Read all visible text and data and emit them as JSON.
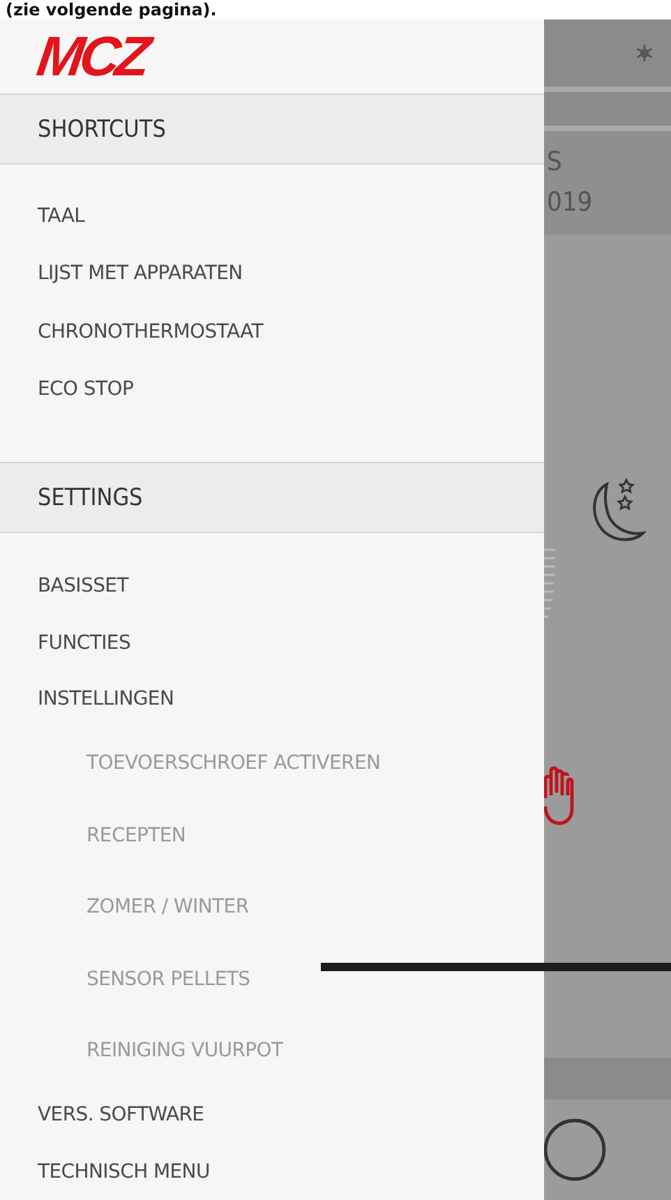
{
  "caption": "(zie volgende pagina).",
  "drawer": {
    "logo": "MCZ",
    "sections": [
      {
        "title": "SHORTCUTS",
        "items": [
          {
            "label": "TAAL"
          },
          {
            "label": "LIJST MET APPARATEN"
          },
          {
            "label": "CHRONOTHERMOSTAAT"
          },
          {
            "label": "ECO STOP"
          }
        ]
      },
      {
        "title": "SETTINGS",
        "items": [
          {
            "label": "BASISSET"
          },
          {
            "label": "FUNCTIES"
          },
          {
            "label": "INSTELLINGEN",
            "children": [
              {
                "label": "TOEVOERSCHROEF ACTIVEREN"
              },
              {
                "label": "RECEPTEN"
              },
              {
                "label": "ZOMER / WINTER"
              },
              {
                "label": "SENSOR PELLETS"
              },
              {
                "label": "REINIGING VUURPOT"
              }
            ]
          },
          {
            "label": "VERS. SOFTWARE"
          },
          {
            "label": "TECHNISCH MENU"
          }
        ]
      }
    ]
  },
  "background": {
    "date_lines": [
      "S",
      "019"
    ]
  }
}
